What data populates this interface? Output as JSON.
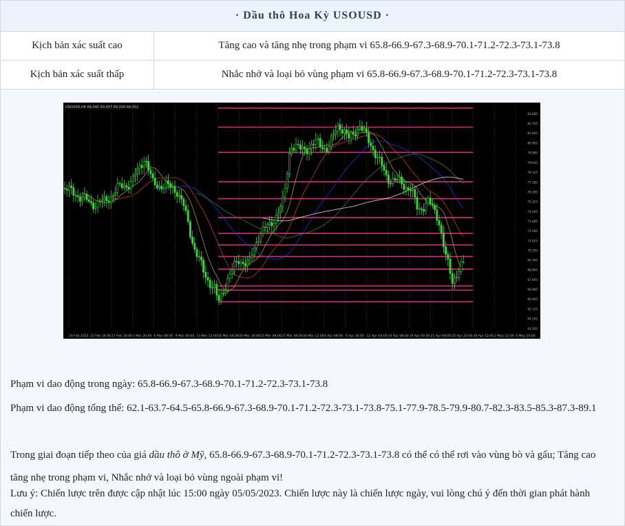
{
  "title": "· Dầu thô Hoa Kỳ USOUSD ·",
  "scenarios": [
    {
      "label": "Kịch bản xác suất cao",
      "text": "Tăng cao và tăng nhẹ trong phạm vi 65.8-66.9-67.3-68.9-70.1-71.2-72.3-73.1-73.8"
    },
    {
      "label": "Kịch bản xác suất thấp",
      "text": "Nhắc nhở và loại bỏ vùng phạm vi 65.8-66.9-67.3-68.9-70.1-71.2-72.3-73.1-73.8"
    }
  ],
  "chart": {
    "header": "USOUSD,H4 69.045 69.407 69.018 69.352",
    "x_labels": [
      "20 Feb 2023",
      "22 Feb 16:00",
      "27 Feb 16:00",
      "1 Mar 20:00",
      "6 Mar 08:00",
      "9 Mar 00:00",
      "13 Mar 12:00",
      "16 Mar 04:00",
      "20 Mar 20:00",
      "23 Mar 08:00",
      "27 Mar 08:00",
      "30 Mar 12:00",
      "4 Apr 08:00",
      "6 Apr 16:00",
      "12 Apr 04:00",
      "14 Apr 08:00",
      "19 Apr 00:00",
      "21 Apr 08:00",
      "25 Apr 20:00",
      "28 Apr 12:00",
      "2 May 12:00",
      "4 May 16:00"
    ],
    "y_labels": [
      "83.685",
      "82.765",
      "81.845",
      "80.905",
      "79.985",
      "79.045",
      "78.125",
      "77.185",
      "76.265",
      "75.325",
      "74.405",
      "73.485",
      "72.565",
      "71.625",
      "70.705",
      "69.765",
      "68.845",
      "67.905",
      "66.985",
      "66.065",
      "65.125",
      "64.205",
      "63.265"
    ],
    "colors": {
      "candle": "#33dd33",
      "level": "#d0307a",
      "background": "#000000"
    }
  },
  "chart_data": {
    "type": "line",
    "symbol": "USOUSD",
    "timeframe": "H4",
    "levels": [
      84.2,
      82.4,
      80.0,
      77.2,
      75.6,
      73.8,
      72.3,
      71.2,
      70.1,
      68.9,
      67.3,
      66.9,
      65.8
    ],
    "ohlc_last": {
      "open": 69.045,
      "high": 69.407,
      "low": 69.018,
      "close": 69.352
    }
  },
  "lines": {
    "intraday_label": "Phạm vi dao động trong ngày:",
    "intraday_value": "65.8-66.9-67.3-68.9-70.1-71.2-72.3-73.1-73.8",
    "overall_label": "Phạm vi dao động tổng thể:",
    "overall_value": "62.1-63.7-64.5-65.8-66.9-67.3-68.9-70.1-71.2-72.3-73.1-73.8-75.1-77.9-78.5-79.9-80.7-82.3-83.5-85.3-87.3-89.1",
    "next_pre": "Trong giai đoạn tiếp theo của giá ",
    "next_em": "dầu thô ở Mỹ",
    "next_post": ", 65.8-66.9-67.3-68.9-70.1-71.2-72.3-73.1-73.8 có thể có thể rơi vào vùng bò và gấu; Tăng cao tăng nhẹ trong phạm vi, Nhắc nhở và loại bỏ vùng ngoài phạm vi!",
    "note": "Lưu ý: Chiến lược trên được cập nhật lúc 15:00 ngày 05/05/2023. Chiến lược này là chiến lược ngày, vui lòng chú ý đến thời gian phát hành chiến lược."
  }
}
